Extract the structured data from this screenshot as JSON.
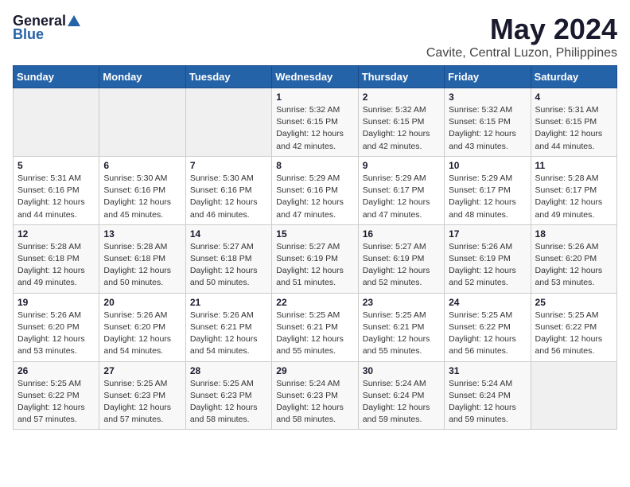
{
  "logo": {
    "general": "General",
    "blue": "Blue"
  },
  "title": "May 2024",
  "subtitle": "Cavite, Central Luzon, Philippines",
  "weekdays": [
    "Sunday",
    "Monday",
    "Tuesday",
    "Wednesday",
    "Thursday",
    "Friday",
    "Saturday"
  ],
  "weeks": [
    [
      {
        "day": "",
        "info": ""
      },
      {
        "day": "",
        "info": ""
      },
      {
        "day": "",
        "info": ""
      },
      {
        "day": "1",
        "info": "Sunrise: 5:32 AM\nSunset: 6:15 PM\nDaylight: 12 hours\nand 42 minutes."
      },
      {
        "day": "2",
        "info": "Sunrise: 5:32 AM\nSunset: 6:15 PM\nDaylight: 12 hours\nand 42 minutes."
      },
      {
        "day": "3",
        "info": "Sunrise: 5:32 AM\nSunset: 6:15 PM\nDaylight: 12 hours\nand 43 minutes."
      },
      {
        "day": "4",
        "info": "Sunrise: 5:31 AM\nSunset: 6:15 PM\nDaylight: 12 hours\nand 44 minutes."
      }
    ],
    [
      {
        "day": "5",
        "info": "Sunrise: 5:31 AM\nSunset: 6:16 PM\nDaylight: 12 hours\nand 44 minutes."
      },
      {
        "day": "6",
        "info": "Sunrise: 5:30 AM\nSunset: 6:16 PM\nDaylight: 12 hours\nand 45 minutes."
      },
      {
        "day": "7",
        "info": "Sunrise: 5:30 AM\nSunset: 6:16 PM\nDaylight: 12 hours\nand 46 minutes."
      },
      {
        "day": "8",
        "info": "Sunrise: 5:29 AM\nSunset: 6:16 PM\nDaylight: 12 hours\nand 47 minutes."
      },
      {
        "day": "9",
        "info": "Sunrise: 5:29 AM\nSunset: 6:17 PM\nDaylight: 12 hours\nand 47 minutes."
      },
      {
        "day": "10",
        "info": "Sunrise: 5:29 AM\nSunset: 6:17 PM\nDaylight: 12 hours\nand 48 minutes."
      },
      {
        "day": "11",
        "info": "Sunrise: 5:28 AM\nSunset: 6:17 PM\nDaylight: 12 hours\nand 49 minutes."
      }
    ],
    [
      {
        "day": "12",
        "info": "Sunrise: 5:28 AM\nSunset: 6:18 PM\nDaylight: 12 hours\nand 49 minutes."
      },
      {
        "day": "13",
        "info": "Sunrise: 5:28 AM\nSunset: 6:18 PM\nDaylight: 12 hours\nand 50 minutes."
      },
      {
        "day": "14",
        "info": "Sunrise: 5:27 AM\nSunset: 6:18 PM\nDaylight: 12 hours\nand 50 minutes."
      },
      {
        "day": "15",
        "info": "Sunrise: 5:27 AM\nSunset: 6:19 PM\nDaylight: 12 hours\nand 51 minutes."
      },
      {
        "day": "16",
        "info": "Sunrise: 5:27 AM\nSunset: 6:19 PM\nDaylight: 12 hours\nand 52 minutes."
      },
      {
        "day": "17",
        "info": "Sunrise: 5:26 AM\nSunset: 6:19 PM\nDaylight: 12 hours\nand 52 minutes."
      },
      {
        "day": "18",
        "info": "Sunrise: 5:26 AM\nSunset: 6:20 PM\nDaylight: 12 hours\nand 53 minutes."
      }
    ],
    [
      {
        "day": "19",
        "info": "Sunrise: 5:26 AM\nSunset: 6:20 PM\nDaylight: 12 hours\nand 53 minutes."
      },
      {
        "day": "20",
        "info": "Sunrise: 5:26 AM\nSunset: 6:20 PM\nDaylight: 12 hours\nand 54 minutes."
      },
      {
        "day": "21",
        "info": "Sunrise: 5:26 AM\nSunset: 6:21 PM\nDaylight: 12 hours\nand 54 minutes."
      },
      {
        "day": "22",
        "info": "Sunrise: 5:25 AM\nSunset: 6:21 PM\nDaylight: 12 hours\nand 55 minutes."
      },
      {
        "day": "23",
        "info": "Sunrise: 5:25 AM\nSunset: 6:21 PM\nDaylight: 12 hours\nand 55 minutes."
      },
      {
        "day": "24",
        "info": "Sunrise: 5:25 AM\nSunset: 6:22 PM\nDaylight: 12 hours\nand 56 minutes."
      },
      {
        "day": "25",
        "info": "Sunrise: 5:25 AM\nSunset: 6:22 PM\nDaylight: 12 hours\nand 56 minutes."
      }
    ],
    [
      {
        "day": "26",
        "info": "Sunrise: 5:25 AM\nSunset: 6:22 PM\nDaylight: 12 hours\nand 57 minutes."
      },
      {
        "day": "27",
        "info": "Sunrise: 5:25 AM\nSunset: 6:23 PM\nDaylight: 12 hours\nand 57 minutes."
      },
      {
        "day": "28",
        "info": "Sunrise: 5:25 AM\nSunset: 6:23 PM\nDaylight: 12 hours\nand 58 minutes."
      },
      {
        "day": "29",
        "info": "Sunrise: 5:24 AM\nSunset: 6:23 PM\nDaylight: 12 hours\nand 58 minutes."
      },
      {
        "day": "30",
        "info": "Sunrise: 5:24 AM\nSunset: 6:24 PM\nDaylight: 12 hours\nand 59 minutes."
      },
      {
        "day": "31",
        "info": "Sunrise: 5:24 AM\nSunset: 6:24 PM\nDaylight: 12 hours\nand 59 minutes."
      },
      {
        "day": "",
        "info": ""
      }
    ]
  ]
}
